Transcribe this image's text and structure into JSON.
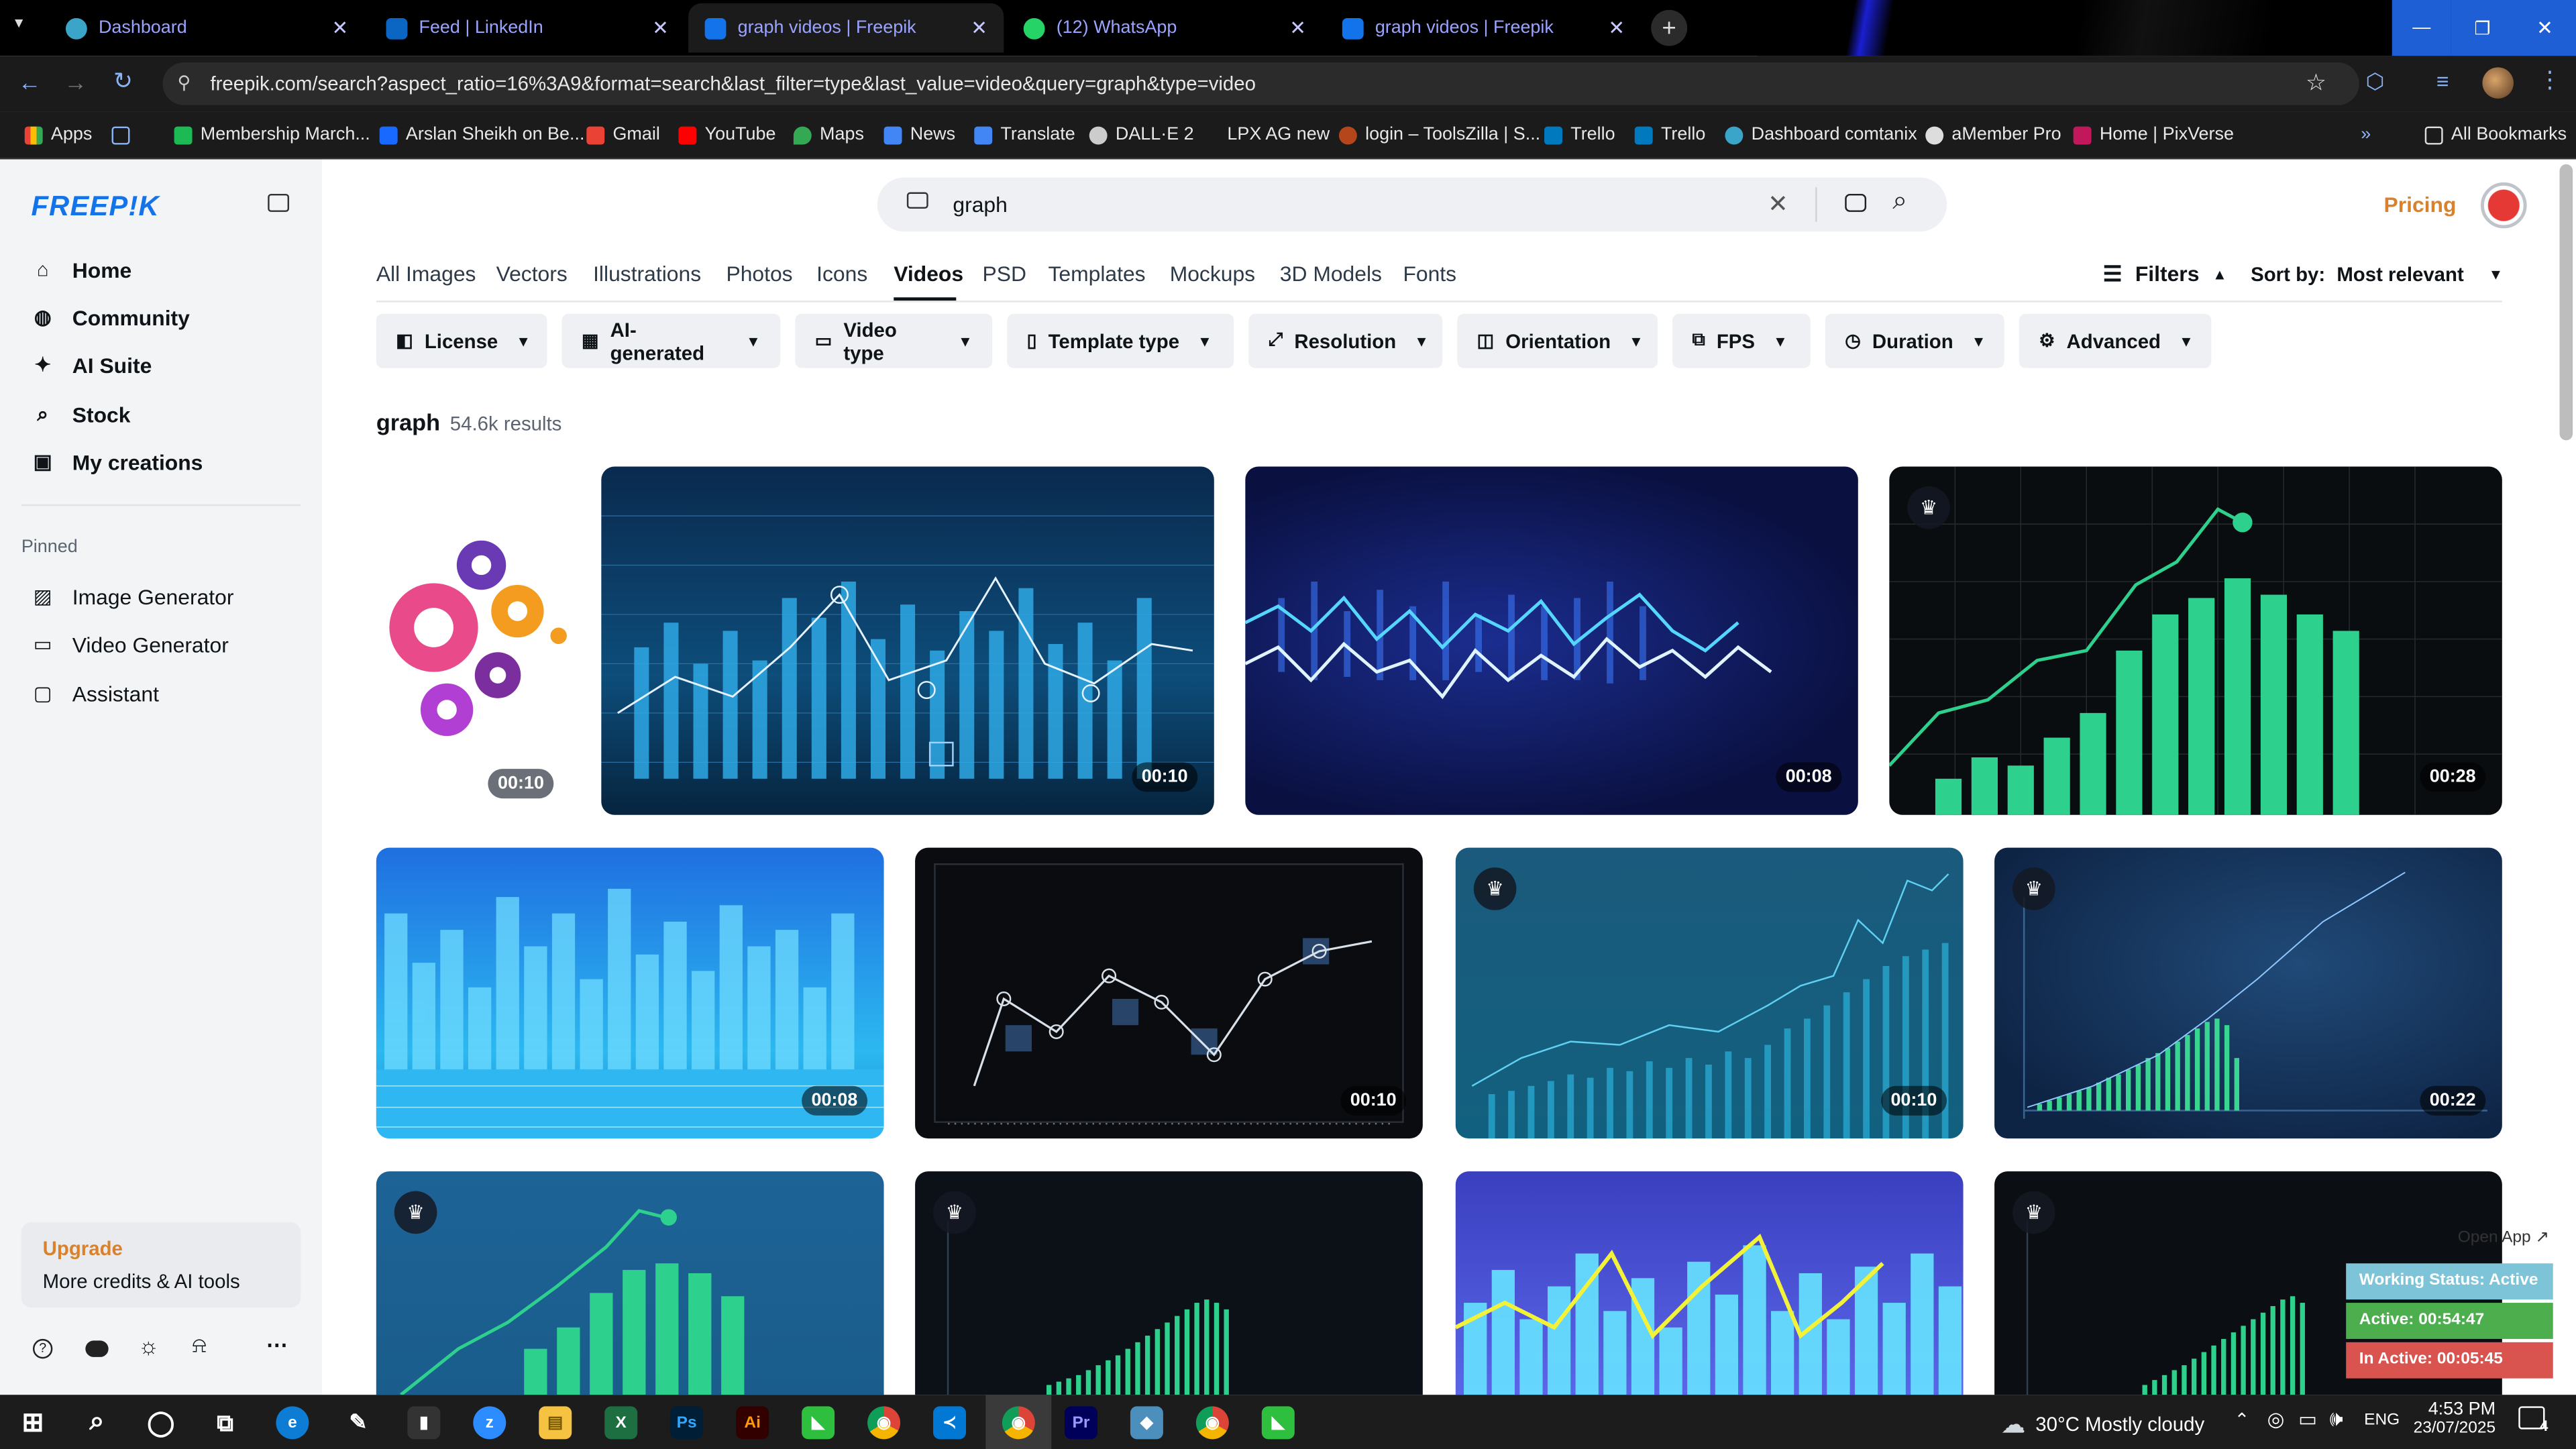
{
  "browser": {
    "tabs": [
      {
        "title": "Dashboard",
        "favicon_color": "#3aa5c9"
      },
      {
        "title": "Feed | LinkedIn",
        "favicon_color": "#0a66c2"
      },
      {
        "title": "graph videos | Freepik",
        "favicon_color": "#1273eb",
        "active": true
      },
      {
        "title": "(12) WhatsApp",
        "favicon_color": "#25d366"
      },
      {
        "title": "graph videos | Freepik",
        "favicon_color": "#1273eb"
      }
    ],
    "new_tab_symbol": "+",
    "window_controls": {
      "minimize": "—",
      "restore": "❐",
      "close": "✕"
    },
    "url": "freepik.com/search?aspect_ratio=16%3A9&format=search&last_filter=type&last_value=video&query=graph&type=video",
    "bookmarks": [
      {
        "label": "Apps",
        "color": "#e8e8e8"
      },
      {
        "label": "Membership March...",
        "color": "#1db954"
      },
      {
        "label": "Arslan Sheikh on Be...",
        "color": "#1769ff"
      },
      {
        "label": "Gmail",
        "color": "#ea4335"
      },
      {
        "label": "YouTube",
        "color": "#ff0000"
      },
      {
        "label": "Maps",
        "color": "#34a853"
      },
      {
        "label": "News",
        "color": "#4285f4"
      },
      {
        "label": "Translate",
        "color": "#4285f4"
      },
      {
        "label": "DALL·E 2",
        "color": "#cccccc"
      },
      {
        "label": "LPX AG new",
        "color": "#1b1b1b"
      },
      {
        "label": "login – ToolsZilla | S...",
        "color": "#b5451b"
      },
      {
        "label": "Trello",
        "color": "#0079bf"
      },
      {
        "label": "Trello",
        "color": "#0079bf"
      },
      {
        "label": "Dashboard comtanix",
        "color": "#3aa5c9"
      },
      {
        "label": "aMember Pro",
        "color": "#dddddd"
      },
      {
        "label": "Home | PixVerse",
        "color": "#c2185b"
      }
    ],
    "more_bookmarks": "»",
    "all_bookmarks": "All Bookmarks"
  },
  "freepik": {
    "logo": "FREEP!K",
    "sidebar": {
      "nav": [
        {
          "label": "Home",
          "icon": "home-icon",
          "glyph": "⌂"
        },
        {
          "label": "Community",
          "icon": "globe-icon",
          "glyph": "◍"
        },
        {
          "label": "AI Suite",
          "icon": "sparkle-icon",
          "glyph": "✦"
        },
        {
          "label": "Stock",
          "icon": "search-icon",
          "glyph": "⌕"
        },
        {
          "label": "My creations",
          "icon": "folder-icon",
          "glyph": "▣"
        }
      ],
      "pinned_heading": "Pinned",
      "pinned": [
        {
          "label": "Image Generator",
          "icon": "image-icon",
          "glyph": "▨"
        },
        {
          "label": "Video Generator",
          "icon": "video-icon",
          "glyph": "▭"
        },
        {
          "label": "Assistant",
          "icon": "chat-icon",
          "glyph": "▢"
        }
      ],
      "upgrade": {
        "title": "Upgrade",
        "subtitle": "More credits & AI tools"
      }
    },
    "search": {
      "value": "graph",
      "clear": "✕"
    },
    "pricing": "Pricing",
    "categories": [
      {
        "label": "All Images"
      },
      {
        "label": "Vectors"
      },
      {
        "label": "Illustrations"
      },
      {
        "label": "Photos"
      },
      {
        "label": "Icons"
      },
      {
        "label": "Videos",
        "active": true
      },
      {
        "label": "PSD"
      },
      {
        "label": "Templates"
      },
      {
        "label": "Mockups"
      },
      {
        "label": "3D Models"
      },
      {
        "label": "Fonts"
      }
    ],
    "filters_label": "Filters",
    "sort": {
      "label": "Sort by:",
      "value": "Most relevant"
    },
    "filter_chips": [
      {
        "label": "License",
        "icon": "license-icon",
        "glyph": "◧"
      },
      {
        "label": "AI-generated",
        "icon": "ai-icon",
        "glyph": "▦"
      },
      {
        "label": "Video type",
        "icon": "video-type-icon",
        "glyph": "▭"
      },
      {
        "label": "Template type",
        "icon": "template-icon",
        "glyph": "▯"
      },
      {
        "label": "Resolution",
        "icon": "resolution-icon",
        "glyph": "⤢"
      },
      {
        "label": "Orientation",
        "icon": "orientation-icon",
        "glyph": "◫"
      },
      {
        "label": "FPS",
        "icon": "fps-icon",
        "glyph": "⧉"
      },
      {
        "label": "Duration",
        "icon": "clock-icon",
        "glyph": "◷"
      },
      {
        "label": "Advanced",
        "icon": "gear-icon",
        "glyph": "⚙"
      }
    ],
    "results": {
      "query": "graph",
      "count": "54.6k results"
    },
    "videos": [
      {
        "duration": "00:10",
        "premium": false,
        "style": "gears"
      },
      {
        "duration": "00:10",
        "premium": false,
        "style": "blue-bars"
      },
      {
        "duration": "00:08",
        "premium": false,
        "style": "waves"
      },
      {
        "duration": "00:28",
        "premium": true,
        "style": "green-growth"
      },
      {
        "duration": "00:08",
        "premium": false,
        "style": "cyan-bars"
      },
      {
        "duration": "00:10",
        "premium": false,
        "style": "dark-line"
      },
      {
        "duration": "00:10",
        "premium": true,
        "style": "teal-rise"
      },
      {
        "duration": "00:22",
        "premium": true,
        "style": "navy-spike"
      },
      {
        "duration": "",
        "premium": true,
        "style": "green-growth-2"
      },
      {
        "duration": "",
        "premium": true,
        "style": "dark-spike"
      },
      {
        "duration": "",
        "premium": false,
        "style": "yellow-zigzag"
      },
      {
        "duration": "",
        "premium": true,
        "style": "dark-spike-2"
      }
    ]
  },
  "overlay": {
    "open_app": "Open App ↗",
    "working_status": "Working Status: Active",
    "active": "Active: 00:54:47",
    "inactive": "In Active: 00:05:45"
  },
  "taskbar": {
    "apps": [
      {
        "name": "start-icon",
        "label": "⊞",
        "bg": "transparent"
      },
      {
        "name": "search-taskbar-icon",
        "label": "⌕",
        "bg": "transparent"
      },
      {
        "name": "cortana-icon",
        "label": "◯",
        "bg": "transparent"
      },
      {
        "name": "task-view-icon",
        "label": "⧉",
        "bg": "transparent"
      },
      {
        "name": "edge-icon",
        "label": "e",
        "bg": "#0c7cd5"
      },
      {
        "name": "pen-icon",
        "label": "✎",
        "bg": "transparent"
      },
      {
        "name": "terminal-icon",
        "label": "▮",
        "bg": "#333"
      },
      {
        "name": "zoom-icon",
        "label": "z",
        "bg": "#2d8cff"
      },
      {
        "name": "file-explorer-icon",
        "label": "▤",
        "bg": "#f5c242"
      },
      {
        "name": "excel-icon",
        "label": "X",
        "bg": "#1d6f42"
      },
      {
        "name": "photoshop-icon",
        "label": "Ps",
        "bg": "#001e36"
      },
      {
        "name": "illustrator-icon",
        "label": "Ai",
        "bg": "#330000"
      },
      {
        "name": "app-green-icon",
        "label": "◣",
        "bg": "#2fbf3f"
      },
      {
        "name": "chrome-icon",
        "label": "◉",
        "bg": "#db4437"
      },
      {
        "name": "vscode-icon",
        "label": "≺",
        "bg": "#0078d4"
      },
      {
        "name": "chrome-active-icon",
        "label": "◉",
        "bg": "#f4b400"
      },
      {
        "name": "premiere-icon",
        "label": "Pr",
        "bg": "#00005b"
      },
      {
        "name": "app-blue-icon",
        "label": "◆",
        "bg": "#4c8fbd"
      },
      {
        "name": "chrome-2-icon",
        "label": "◉",
        "bg": "#0f9d58"
      },
      {
        "name": "app-green-2-icon",
        "label": "◣",
        "bg": "#2fbf3f"
      }
    ],
    "weather": "30°C  Mostly cloudy",
    "lang": "ENG",
    "time": "4:53 PM",
    "date": "23/07/2025",
    "notifications": "4"
  }
}
